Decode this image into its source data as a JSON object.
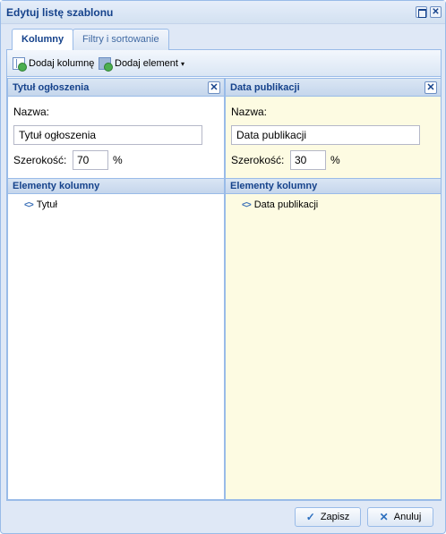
{
  "window": {
    "title": "Edytuj listę szablonu",
    "maximize_symbol": "",
    "close_symbol": "✕"
  },
  "tabs": [
    {
      "label": "Kolumny",
      "active": true
    },
    {
      "label": "Filtry i sortowanie",
      "active": false
    }
  ],
  "toolbar": {
    "add_column_label": "Dodaj kolumnę",
    "add_element_label": "Dodaj element",
    "add_element_caret": "▾"
  },
  "columns": [
    {
      "header": "Tytuł ogłoszenia",
      "name_label": "Nazwa:",
      "name_value": "Tytuł ogłoszenia",
      "width_label": "Szerokość:",
      "width_value": "70",
      "width_unit": "%",
      "elements_header": "Elementy kolumny",
      "elements": [
        {
          "icon": "<>",
          "label": "Tytuł"
        }
      ],
      "background": "#ffffff"
    },
    {
      "header": "Data publikacji",
      "name_label": "Nazwa:",
      "name_value": "Data publikacji",
      "width_label": "Szerokość:",
      "width_value": "30",
      "width_unit": "%",
      "elements_header": "Elementy kolumny",
      "elements": [
        {
          "icon": "<>",
          "label": "Data publikacji"
        }
      ],
      "background": "#fdfbe2"
    }
  ],
  "column_close_symbol": "✕",
  "buttons": {
    "save_label": "Zapisz",
    "save_icon": "✓",
    "cancel_label": "Anuluj",
    "cancel_icon": "✕"
  },
  "colors": {
    "accent": "#15428b",
    "border": "#99bbe8",
    "window_bg": "#dfe8f6"
  }
}
